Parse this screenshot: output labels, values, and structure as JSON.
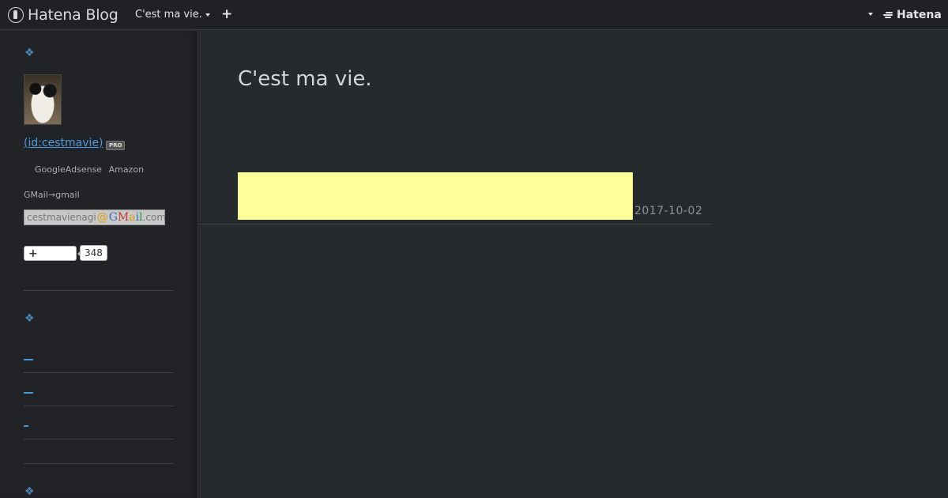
{
  "topbar": {
    "brand": "Hatena Blog",
    "blog_menu": "C'est ma vie.",
    "plus_label": "+",
    "hatena_label": "Hatena"
  },
  "sidebar": {
    "section_icon": "❖",
    "user_id": "(id:cestmavie)",
    "pro_badge": "PRO",
    "sponsors": [
      "GoogleAdsense",
      "Amazon"
    ],
    "gmail_label": "GMail→gmail",
    "gmail_address": {
      "user": "cestmavienagi",
      "at": "@",
      "domain_brand": "GMail",
      "tld": ".com"
    },
    "follow_plus": "+",
    "follow_count": "348",
    "links": [
      "__",
      "__",
      "_"
    ]
  },
  "main": {
    "blog_title": "C'est ma vie.",
    "entry_date": "2017-10-02"
  },
  "colors": {
    "background": "#272a2d",
    "sidebar": "#212326",
    "topbar": "#1f2124",
    "link": "#4b9be0",
    "highlight": "#ffff99",
    "accent_diamond": "#4a86b8"
  },
  "icons": {
    "brand": "hatena-blog-logo-icon",
    "plus": "plus-icon",
    "caret": "chevron-down-icon",
    "hatena": "hatena-logo-icon",
    "diamond": "diamond-ornament-icon"
  }
}
